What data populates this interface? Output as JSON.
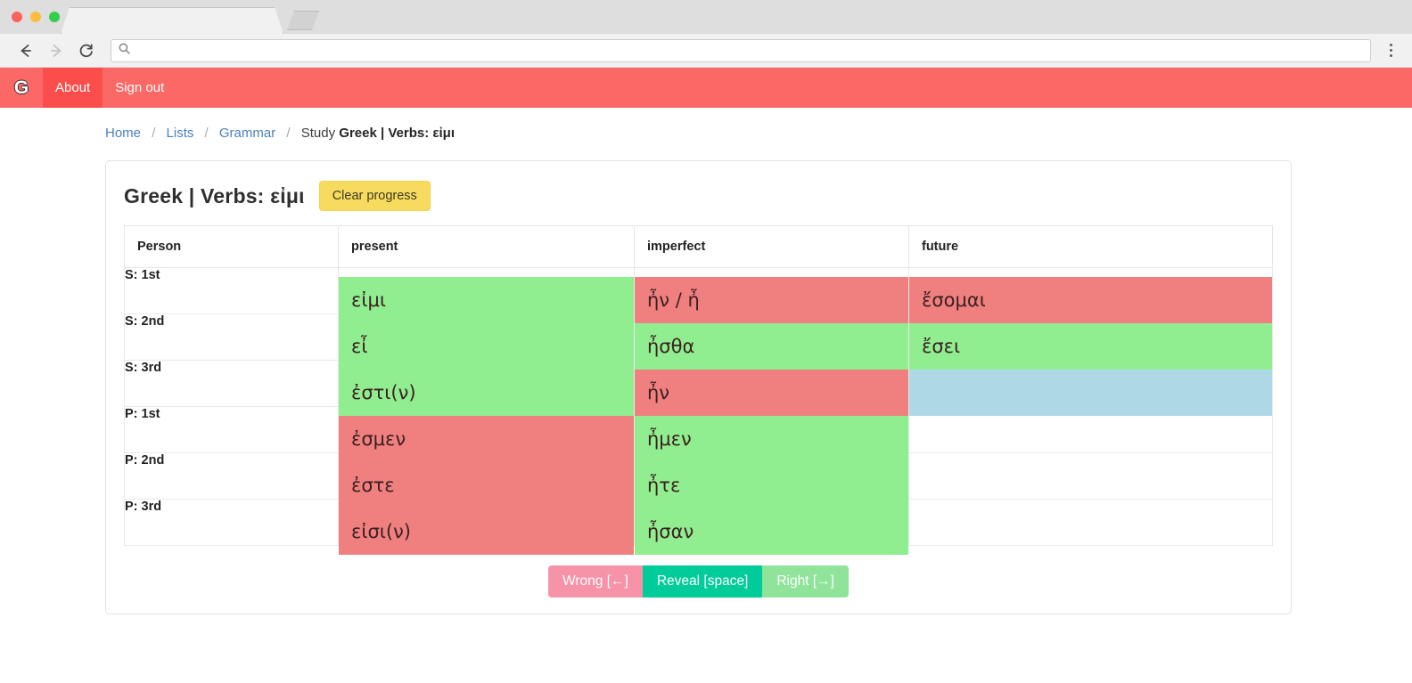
{
  "browser": {
    "back_icon": "back-arrow-icon",
    "forward_icon": "forward-arrow-icon",
    "reload_icon": "reload-icon",
    "search_icon": "search-icon",
    "menu_icon": "kebab-menu-icon",
    "url_value": "",
    "url_placeholder": "",
    "tab_title": ""
  },
  "navbar": {
    "brand": "G",
    "links": [
      {
        "label": "About",
        "active": true
      },
      {
        "label": "Sign out",
        "active": false
      }
    ],
    "background": "#fc6866"
  },
  "breadcrumb": {
    "items": [
      {
        "label": "Home",
        "link": true
      },
      {
        "label": "Lists",
        "link": true
      },
      {
        "label": "Grammar",
        "link": true
      }
    ],
    "separator": "/",
    "current_prefix": "Study",
    "current_strong": "Greek | Verbs: εἰμι"
  },
  "card": {
    "title": "Greek | Verbs: εἰμι",
    "clear_button": "Clear progress",
    "clear_button_color": "#f7db5e"
  },
  "table": {
    "headers": [
      "Person",
      "present",
      "imperfect",
      "future"
    ],
    "rows": [
      {
        "person": "S: 1st",
        "cells": [
          {
            "text": "εἰμι",
            "state": "green"
          },
          {
            "text": "ἦν / ἦ",
            "state": "red"
          },
          {
            "text": "ἔσομαι",
            "state": "red"
          }
        ]
      },
      {
        "person": "S: 2nd",
        "cells": [
          {
            "text": "εἶ",
            "state": "green"
          },
          {
            "text": "ἦσθα",
            "state": "green"
          },
          {
            "text": "ἔσει",
            "state": "green"
          }
        ]
      },
      {
        "person": "S: 3rd",
        "cells": [
          {
            "text": "ἐστι(ν)",
            "state": "green"
          },
          {
            "text": "ἦν",
            "state": "red"
          },
          {
            "text": "",
            "state": "blue"
          }
        ]
      },
      {
        "person": "P: 1st",
        "cells": [
          {
            "text": "ἐσμεν",
            "state": "red"
          },
          {
            "text": "ἦμεν",
            "state": "green"
          },
          {
            "text": "",
            "state": "blank"
          }
        ]
      },
      {
        "person": "P: 2nd",
        "cells": [
          {
            "text": "ἐστε",
            "state": "red"
          },
          {
            "text": "ἦτε",
            "state": "green"
          },
          {
            "text": "",
            "state": "blank"
          }
        ]
      },
      {
        "person": "P: 3rd",
        "cells": [
          {
            "text": "εἰσι(ν)",
            "state": "red"
          },
          {
            "text": "ἦσαν",
            "state": "green"
          },
          {
            "text": "",
            "state": "blank"
          }
        ]
      }
    ],
    "state_colors": {
      "green": "#90ee90",
      "red": "#f08080",
      "blue": "#add8e6"
    }
  },
  "controls": {
    "wrong": "Wrong [←]",
    "reveal": "Reveal [space]",
    "right": "Right [→]",
    "wrong_color": "#f793a8",
    "reveal_color": "#00cc99",
    "right_color": "#8fe49a"
  }
}
